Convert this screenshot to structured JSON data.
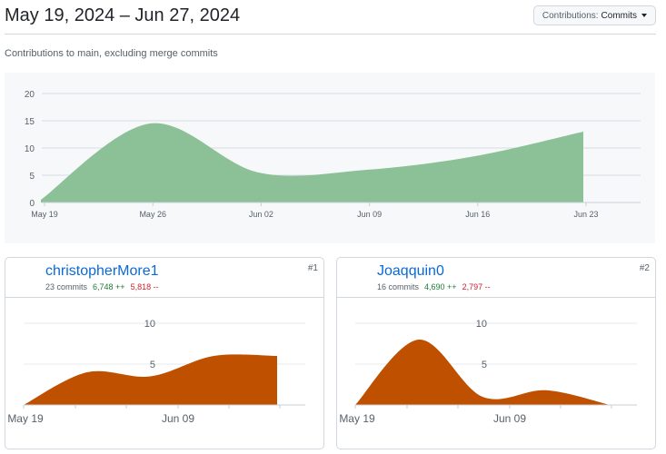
{
  "header": {
    "date_range": "May 19, 2024 – Jun 27, 2024",
    "contributions_label": "Contributions:",
    "contributions_value": "Commits"
  },
  "subtitle": "Contributions to main, excluding merge commits",
  "colors": {
    "main_fill": "#8cc096",
    "user_fill": "#bf5000",
    "link": "#0969da",
    "additions": "#1a7f37",
    "deletions": "#cf222e"
  },
  "chart_data": [
    {
      "type": "area",
      "id": "overall",
      "x_labels": [
        "May 19",
        "May 26",
        "Jun 02",
        "Jun 09",
        "Jun 16",
        "Jun 23"
      ],
      "x": [
        0,
        1,
        2,
        3,
        4,
        5
      ],
      "values": [
        0.5,
        14.5,
        5.5,
        6,
        8.5,
        13
      ],
      "ylim": [
        0,
        20
      ],
      "yticks": [
        "0",
        "5",
        "10",
        "15",
        "20"
      ],
      "grid": true
    },
    {
      "type": "area",
      "id": "christopherMore1",
      "x_labels": [
        "May 19",
        "Jun 09"
      ],
      "values": [
        0,
        4,
        3.5,
        6,
        6
      ],
      "ylim": [
        0,
        10
      ],
      "yticks": [
        "5",
        "10"
      ],
      "grid": true
    },
    {
      "type": "area",
      "id": "Joaqquin0",
      "x_labels": [
        "May 19",
        "Jun 09"
      ],
      "values": [
        0,
        8,
        1,
        1.8,
        0
      ],
      "ylim": [
        0,
        10
      ],
      "yticks": [
        "5",
        "10"
      ],
      "grid": true
    }
  ],
  "contributors": [
    {
      "name": "christopherMore1",
      "commits": "23 commits",
      "additions": "6,748 ++",
      "deletions": "5,818 --",
      "rank": "#1"
    },
    {
      "name": "Joaqquin0",
      "commits": "16 commits",
      "additions": "4,690 ++",
      "deletions": "2,797 --",
      "rank": "#2"
    }
  ]
}
